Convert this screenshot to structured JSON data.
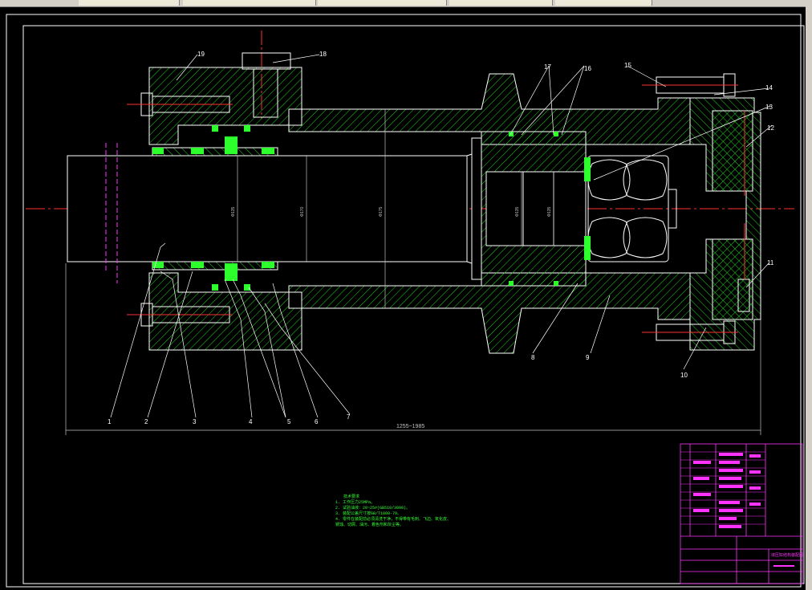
{
  "colors": {
    "background": "#000000",
    "outline": "#ffffff",
    "hatch": "#1fd11f",
    "seal_fill": "#2dff2d",
    "centerline": "#ff3030",
    "leader": "#ffffff",
    "title_block": "#ff33ff",
    "notes": "#33ff33",
    "dim": "#c0c0c0"
  },
  "part_labels": [
    "1",
    "2",
    "3",
    "4",
    "5",
    "6",
    "7",
    "8",
    "9",
    "10",
    "11",
    "12",
    "13",
    "14",
    "15",
    "16",
    "17",
    "18",
    "19"
  ],
  "overall_dimension": "1255~1985",
  "dim_marks": [
    "Φ135",
    "Φ170",
    "Φ175",
    "Φ135",
    "Φ135"
  ],
  "notes": {
    "title": "技术要求",
    "lines": [
      "1. 工作压力25MPa。",
      "2. 试验油液：20~25#(GB510/3000)。",
      "3. 装配公差尺寸按GB/T1800-79。",
      "4. 零件在装配前必须清洗干净，不得带有毛刺、飞边、氧化皮、",
      "锈蚀、切屑、油污、着色剂和灰尘等。"
    ]
  },
  "title_block": {
    "drawing_name": "液压缸结构装配图"
  }
}
